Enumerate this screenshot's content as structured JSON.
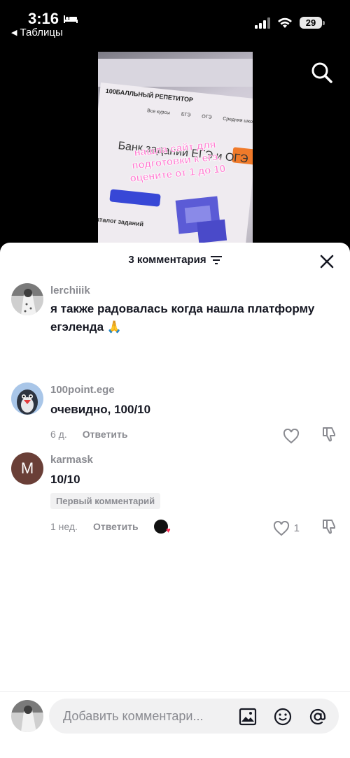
{
  "status_bar": {
    "time": "3:16",
    "back_label": "Таблицы",
    "battery": "29"
  },
  "video": {
    "overlay_text": "нашла сайт для подготовки к егэ, оцените от 1 до 10",
    "thumb_logo": "100БАЛЛЬНЫЙ РЕПЕТИТОР",
    "thumb_nav": [
      "Все курсы",
      "ЕГЭ",
      "ОГЭ",
      "Средняя школа"
    ],
    "thumb_bank": "Банк заданий ЕГЭ и ОГЭ",
    "thumb_catalog": "Каталог заданий"
  },
  "sheet": {
    "title": "3 комментария",
    "comments": [
      {
        "username": "lerchiiik",
        "text": "я также радовалась когда нашла платформу егэленда 🙏"
      },
      {
        "username": "100point.ege",
        "text": "очевидно, 100/10",
        "time": "6 д.",
        "reply": "Ответить"
      },
      {
        "username": "karmask",
        "avatar_letter": "M",
        "text": "10/10",
        "badge": "Первый комментарий",
        "time": "1 нед.",
        "reply": "Ответить",
        "likes": "1"
      }
    ]
  },
  "input": {
    "placeholder": "Добавить комментари..."
  },
  "colors": {
    "accent": "#fe2c55",
    "secondary_text": "#8a8b91",
    "primary_text": "#161823"
  }
}
